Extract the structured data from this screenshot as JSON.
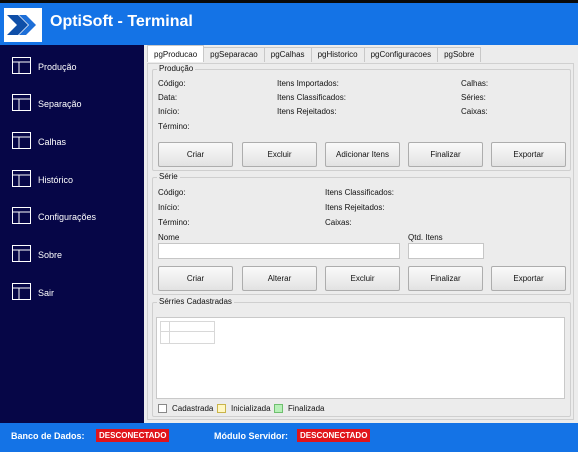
{
  "app": {
    "title": "OptiSoft - Terminal",
    "brand_color": "#1473e6",
    "sidebar_color": "#060647"
  },
  "sidebar": {
    "items": [
      {
        "label": "Produção",
        "icon": "window-icon"
      },
      {
        "label": "Separação",
        "icon": "window-icon"
      },
      {
        "label": "Calhas",
        "icon": "window-icon"
      },
      {
        "label": "Histórico",
        "icon": "window-icon"
      },
      {
        "label": "Configurações",
        "icon": "window-icon"
      },
      {
        "label": "Sobre",
        "icon": "window-icon"
      },
      {
        "label": "Sair",
        "icon": "window-icon"
      }
    ]
  },
  "tabs": [
    {
      "label": "pgProducao",
      "active": true
    },
    {
      "label": "pgSeparacao",
      "active": false
    },
    {
      "label": "pgCalhas",
      "active": false
    },
    {
      "label": "pgHistorico",
      "active": false
    },
    {
      "label": "pgConfiguracoes",
      "active": false
    },
    {
      "label": "pgSobre",
      "active": false
    }
  ],
  "producao": {
    "title": "Produção",
    "col1": [
      "Código:",
      "Data:",
      "Início:",
      "Término:"
    ],
    "col2": [
      "Itens Importados:",
      "Itens Classificados:",
      "Itens Rejeitados:"
    ],
    "col3": [
      "Calhas:",
      "Séries:",
      "Caixas:"
    ],
    "buttons": [
      "Criar",
      "Excluir",
      "Adicionar Itens",
      "Finalizar",
      "Exportar"
    ]
  },
  "serie": {
    "title": "Série",
    "col1": [
      "Código:",
      "Início:",
      "Término:"
    ],
    "col2": [
      "Itens Classificados:",
      "Itens Rejeitados:",
      "Caixas:"
    ],
    "nome_label": "Nome",
    "nome_value": "",
    "qtd_label": "Qtd. Itens",
    "qtd_value": "",
    "buttons": [
      "Criar",
      "Alterar",
      "Excluir",
      "Finalizar",
      "Exportar"
    ]
  },
  "series_cadastradas": {
    "title": "Sérries Cadastradas",
    "legend": [
      {
        "label": "Cadastrada",
        "color": "#ffffff"
      },
      {
        "label": "Inicializada",
        "color": "#fff7c2"
      },
      {
        "label": "Finalizada",
        "color": "#b7f0b7"
      }
    ]
  },
  "status": {
    "db_label": "Banco de Dados:",
    "db_value": "DESCONECTADO",
    "server_label": "Módulo Servidor:",
    "server_value": "DESCONECTADO",
    "badge_color": "#e0141b"
  }
}
